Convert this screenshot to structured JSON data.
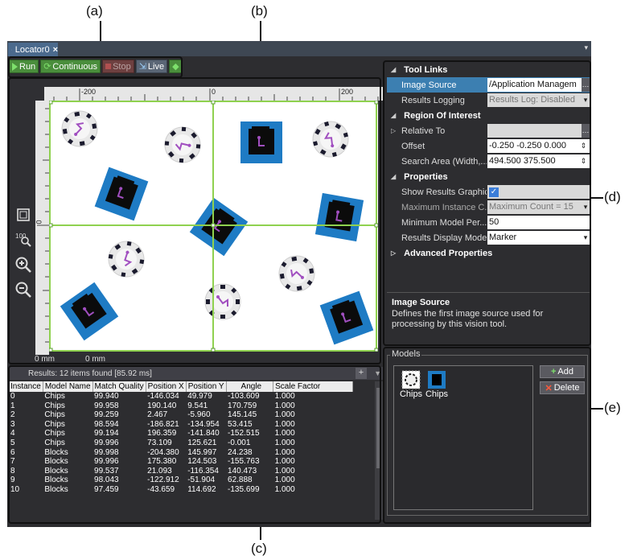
{
  "callouts": {
    "a": "(a)",
    "b": "(b)",
    "c": "(c)",
    "d": "(d)",
    "e": "(e)"
  },
  "tab": {
    "title": "Locator0",
    "close": "×",
    "overflow": "▾"
  },
  "toolbar": {
    "run": "Run",
    "continuous": "Continuous",
    "stop": "Stop",
    "live": "Live"
  },
  "viewer": {
    "ruler_x_labels": [
      "-200",
      "0",
      "200"
    ],
    "ruler_y_label": "0",
    "bottom_left": "0 mm",
    "bottom_right": "0 mm",
    "tools": [
      "fit-icon",
      "zoom-100-icon",
      "zoom-in-icon",
      "zoom-out-icon"
    ]
  },
  "results": {
    "title": "Results: 12 items found [85.92 ms]",
    "plus": "+",
    "columns": [
      "Instance",
      "Model Name",
      "Match Quality",
      "Position X",
      "Position Y",
      "Angle",
      "Scale Factor"
    ],
    "rows": [
      [
        "0",
        "Chips",
        "99.940",
        "-146.034",
        "49.979",
        "-103.609",
        "1.000"
      ],
      [
        "1",
        "Chips",
        "99.958",
        "190.140",
        "9.541",
        "170.759",
        "1.000"
      ],
      [
        "2",
        "Chips",
        "99.259",
        "2.467",
        "-5.960",
        "145.145",
        "1.000"
      ],
      [
        "3",
        "Chips",
        "98.594",
        "-186.821",
        "-134.954",
        "53.415",
        "1.000"
      ],
      [
        "4",
        "Chips",
        "99.194",
        "196.359",
        "-141.840",
        "-152.515",
        "1.000"
      ],
      [
        "5",
        "Chips",
        "99.996",
        "73.109",
        "125.621",
        "-0.001",
        "1.000"
      ],
      [
        "6",
        "Blocks",
        "99.998",
        "-204.380",
        "145.997",
        "24.238",
        "1.000"
      ],
      [
        "7",
        "Blocks",
        "99.996",
        "175.380",
        "124.503",
        "-155.763",
        "1.000"
      ],
      [
        "8",
        "Blocks",
        "99.537",
        "21.093",
        "-116.354",
        "140.473",
        "1.000"
      ],
      [
        "9",
        "Blocks",
        "98.043",
        "-122.912",
        "-51.904",
        "62.888",
        "1.000"
      ],
      [
        "10",
        "Blocks",
        "97.459",
        "-43.659",
        "114.692",
        "-135.699",
        "1.000"
      ]
    ]
  },
  "properties": {
    "categories": {
      "tool_links": "Tool Links",
      "roi": "Region Of Interest",
      "props": "Properties",
      "advanced": "Advanced Properties"
    },
    "image_source": {
      "name": "Image Source",
      "value": "/Application Managem"
    },
    "results_logging": {
      "name": "Results Logging",
      "value": "Results Log: Disabled"
    },
    "relative_to": {
      "name": "Relative To",
      "value": ""
    },
    "offset": {
      "name": "Offset",
      "value": "-0.250 -0.250 0.000"
    },
    "search_area": {
      "name": "Search Area (Width,...",
      "value": "494.500 375.500"
    },
    "show_results_graphics": {
      "name": "Show Results Graphics",
      "checked": true
    },
    "max_instance": {
      "name": "Maximum Instance C...",
      "value": "Maximum Count = 15"
    },
    "min_model": {
      "name": "Minimum Model Per...",
      "value": "50"
    },
    "results_display": {
      "name": "Results Display Mode",
      "value": "Marker"
    },
    "description": {
      "title": "Image Source",
      "text": "Defines the first image source used for processing by this vision tool."
    }
  },
  "models": {
    "legend": "Models",
    "items": [
      "Chips",
      "Chips"
    ],
    "add": "Add",
    "delete": "Delete"
  },
  "colors": {
    "accent_green": "#8fd14f",
    "block_blue": "#1e7bc4",
    "model_purple": "#a14fc0"
  }
}
